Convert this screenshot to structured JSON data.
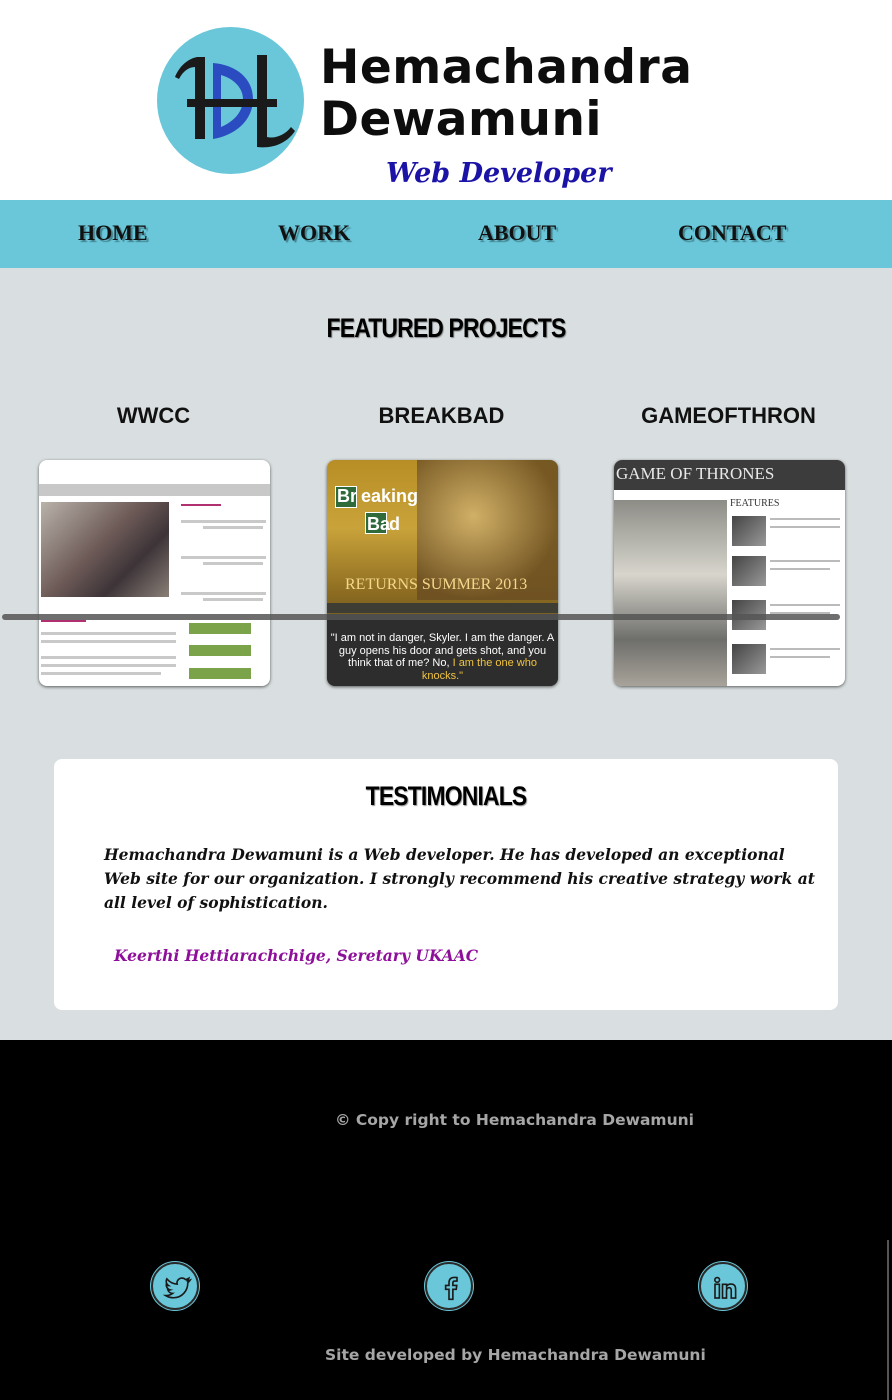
{
  "header": {
    "logo_line1": "Hemachandra",
    "logo_line2": "Dewamuni",
    "subtitle": "Web Developer"
  },
  "nav": {
    "items": [
      {
        "label": "HOME"
      },
      {
        "label": "WORK"
      },
      {
        "label": "ABOUT"
      },
      {
        "label": "CONTACT"
      }
    ]
  },
  "featured": {
    "title": "FEATURED PROJECTS",
    "projects": [
      {
        "label": "WWCC"
      },
      {
        "label": "BREAKBAD",
        "thumb_line1": "Br",
        "thumb_line1b": "eaking",
        "thumb_line2": "Ba",
        "thumb_line2b": "d",
        "thumb_tagline": "RETURNS SUMMER 2013",
        "thumb_quote": "\"I am not in danger, Skyler. I am the danger. A guy opens his door and gets shot, and you think that of me? No,",
        "thumb_quote_highlight": "I am the one who knocks.\""
      },
      {
        "label": "GAMEOFTHRON",
        "thumb_header": "GAME OF THRONES",
        "thumb_features": "FEATURES"
      }
    ]
  },
  "testimonials": {
    "title": "TESTIMONIALS",
    "quote": "Hemachandra Dewamuni is a Web developer. He has developed an exceptional Web site for our organization. I strongly recommend his creative strategy work at all level of sophistication.",
    "author": "Keerthi Hettiarachchige, Seretary UKAAC"
  },
  "footer": {
    "copyright": "© Copy right to Hemachandra Dewamuni",
    "social": [
      {
        "icon": "twitter-icon"
      },
      {
        "icon": "facebook-icon"
      },
      {
        "icon": "linkedin-icon"
      }
    ],
    "site_developed": "Site developed by Hemachandra Dewamuni"
  },
  "colors": {
    "accent": "#69c7d9",
    "page_bg": "#d9dfe0",
    "footer_bg": "#000000",
    "subtitle": "#1b12a6",
    "author": "#8e0f9a"
  }
}
